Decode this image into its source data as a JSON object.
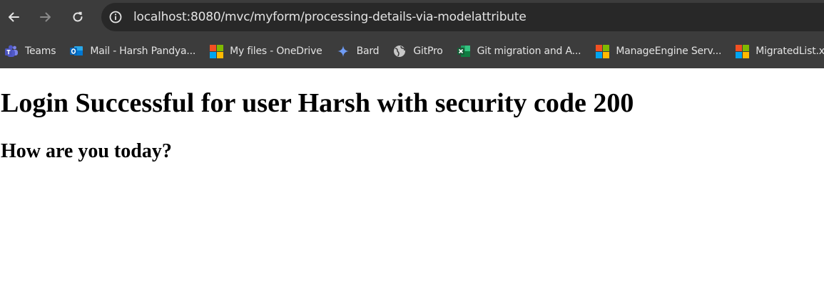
{
  "browser": {
    "url": "localhost:8080/mvc/myform/processing-details-via-modelattribute",
    "toolbar_color": "#3c3c3c",
    "omnibox_color": "#282828",
    "text_color": "#e3e3e3"
  },
  "bookmarks": [
    {
      "label": "Teams",
      "icon": "teams-icon"
    },
    {
      "label": "Mail - Harsh Pandya...",
      "icon": "outlook-icon"
    },
    {
      "label": "My files - OneDrive",
      "icon": "microsoft-icon"
    },
    {
      "label": "Bard",
      "icon": "bard-sparkle-icon"
    },
    {
      "label": "GitPro",
      "icon": "globe-icon"
    },
    {
      "label": "Git migration and A...",
      "icon": "excel-icon"
    },
    {
      "label": "ManageEngine Serv...",
      "icon": "microsoft-icon"
    },
    {
      "label": "MigratedList.xlsx",
      "icon": "microsoft-icon"
    }
  ],
  "page": {
    "heading": "Login Successful for user Harsh with security code 200",
    "subheading": "How are you today?"
  }
}
